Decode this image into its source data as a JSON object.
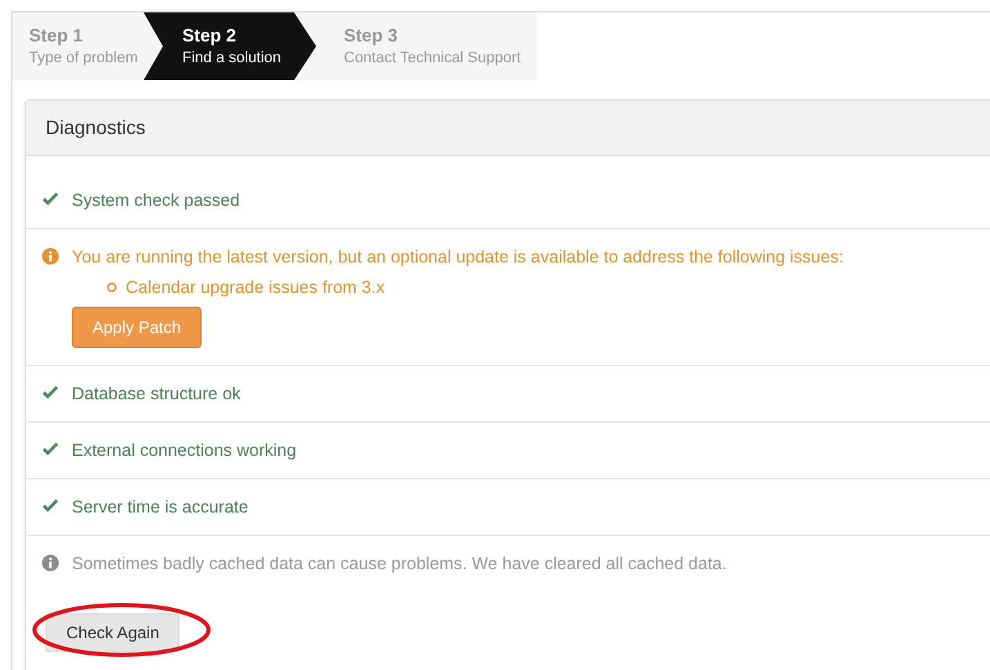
{
  "steps": [
    {
      "title": "Step 1",
      "subtitle": "Type of problem",
      "selected": false
    },
    {
      "title": "Step 2",
      "subtitle": "Find a solution",
      "selected": true
    },
    {
      "title": "Step 3",
      "subtitle": "Contact Technical Support",
      "selected": false
    }
  ],
  "panel": {
    "title": "Diagnostics",
    "checks": [
      {
        "kind": "ok",
        "text": "System check passed"
      },
      {
        "kind": "warning",
        "text": "You are running the latest version, but an optional update is available to address the following issues:",
        "issues": [
          "Calendar upgrade issues from 3.x"
        ],
        "button": "Apply Patch"
      },
      {
        "kind": "ok",
        "text": "Database structure ok"
      },
      {
        "kind": "ok",
        "text": "External connections working"
      },
      {
        "kind": "ok",
        "text": "Server time is accurate"
      },
      {
        "kind": "info",
        "text": "Sometimes badly cached data can cause problems. We have cleared all cached data."
      }
    ],
    "button": "Check Again"
  }
}
